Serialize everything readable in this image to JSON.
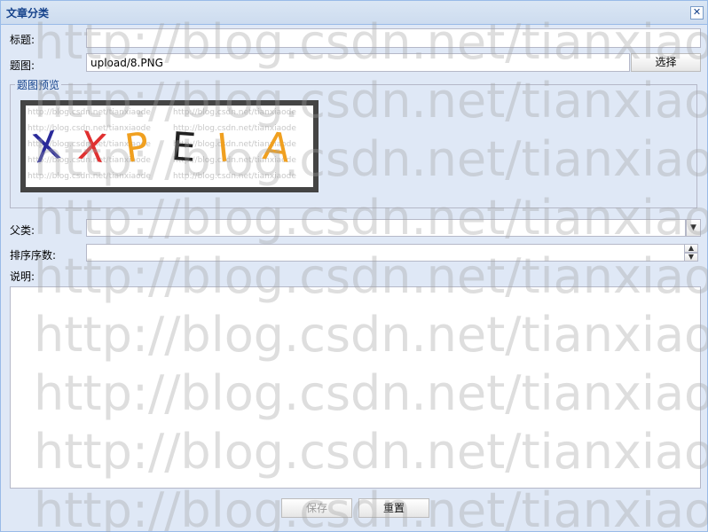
{
  "window": {
    "title": "文章分类",
    "close_glyph": "✕"
  },
  "form": {
    "title_label": "标题:",
    "title_value": "",
    "image_label": "题图:",
    "image_value": "upload/8.PNG",
    "choose_label": "选择",
    "preview_legend": "题图预览",
    "captcha_text": "XXPEIA",
    "parent_label": "父类:",
    "parent_value": "",
    "order_label": "排序序数:",
    "order_value": "",
    "desc_label": "说明:",
    "desc_value": ""
  },
  "footer": {
    "save_label": "保存",
    "reset_label": "重置"
  },
  "watermark_text": "http://blog.csdn.net/tianxiaode",
  "colors": {
    "accent": "#15428b",
    "border": "#99bbe8",
    "bg": "#dfe8f6"
  }
}
